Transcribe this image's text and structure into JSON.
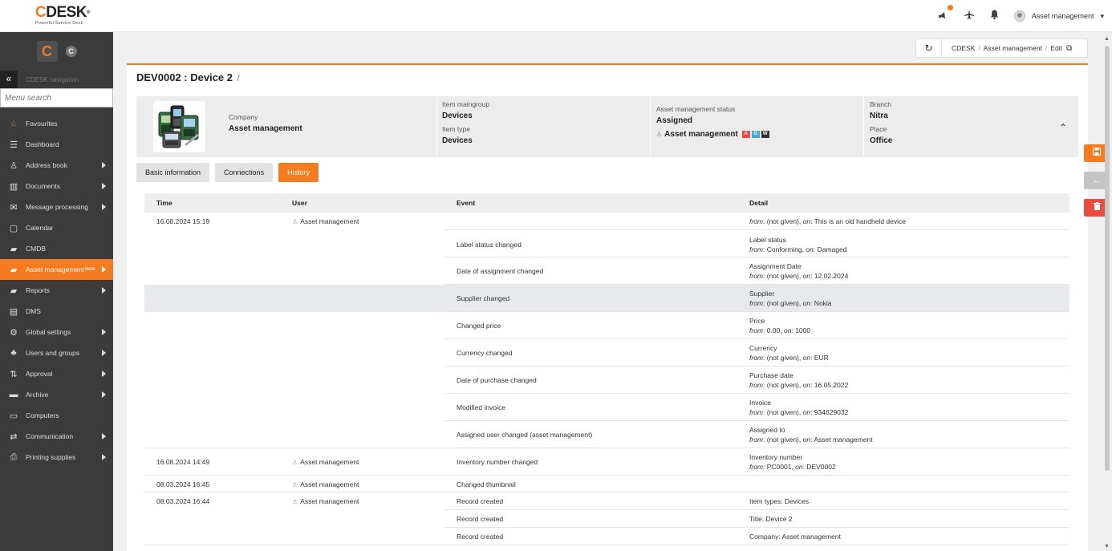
{
  "header": {
    "logo_text": "CDESK",
    "logo_c": "C",
    "logo_rest": "DESK",
    "logo_reg": "®",
    "logo_sub": "Powerful Service Desk",
    "user_name": "Asset management",
    "user_caret": "▾",
    "icons": [
      "megaphone-icon",
      "airplane-icon",
      "bell-icon",
      "avatar"
    ]
  },
  "sidebar": {
    "brand_big": "C",
    "brand_small": "C",
    "collapse_glyph": "«",
    "nav_title": "CDESK navigation",
    "search_placeholder": "Menu search",
    "items": [
      {
        "label": "Favourites",
        "icon": "☆",
        "arrow": false
      },
      {
        "label": "Dashboard",
        "icon": "☰",
        "arrow": false
      },
      {
        "label": "Address book",
        "icon": "♙",
        "arrow": true
      },
      {
        "label": "Documents",
        "icon": "▥",
        "arrow": true
      },
      {
        "label": "Message processing",
        "icon": "✉",
        "arrow": true
      },
      {
        "label": "Calendar",
        "icon": "▢",
        "arrow": false
      },
      {
        "label": "CMDB",
        "icon": "▰",
        "arrow": false
      },
      {
        "label": "Asset management",
        "icon": "▰",
        "arrow": true,
        "badge": "Beta"
      },
      {
        "label": "Reports",
        "icon": "▰",
        "arrow": true
      },
      {
        "label": "DMS",
        "icon": "▤",
        "arrow": false
      },
      {
        "label": "Global settings",
        "icon": "⚙",
        "arrow": true
      },
      {
        "label": "Users and groups",
        "icon": "♣",
        "arrow": true
      },
      {
        "label": "Approval",
        "icon": "⇅",
        "arrow": true
      },
      {
        "label": "Archive",
        "icon": "▬",
        "arrow": true
      },
      {
        "label": "Computers",
        "icon": "▭",
        "arrow": false
      },
      {
        "label": "Communication",
        "icon": "⇄",
        "arrow": true
      },
      {
        "label": "Printing supplies",
        "icon": "⎙",
        "arrow": true
      }
    ]
  },
  "breadcrumb": {
    "refresh_glyph": "↻",
    "part1": "CDESK",
    "part2": "Asset management",
    "part3": "Edit",
    "sep": "/",
    "edit_glyph": "⧉"
  },
  "page": {
    "title": "DEV0002 : Device 2",
    "title_suffix": "/"
  },
  "summary": {
    "company_label": "Company",
    "company_value": "Asset management",
    "maingroup_label": "Item maingroup",
    "maingroup_value": "Devices",
    "type_label": "Item type",
    "type_value": "Devices",
    "status_label": "Asset management status",
    "status_value": "Assigned",
    "owner_value": "Asset management",
    "tags": [
      {
        "text": "A",
        "color": "#e74c3c"
      },
      {
        "text": "O",
        "color": "#3fa9d9"
      },
      {
        "text": "W",
        "color": "#333333"
      }
    ],
    "branch_label": "Branch",
    "branch_value": "Nitra",
    "place_label": "Place",
    "place_value": "Office",
    "collapse_glyph": "⌃"
  },
  "tabs": [
    "Basic information",
    "Connections",
    "History"
  ],
  "history": {
    "headers": {
      "time": "Time",
      "user": "User",
      "event": "Event",
      "detail": "Detail"
    },
    "rows": [
      {
        "time": "16.08.2024 15:19",
        "user": "Asset management",
        "event": "",
        "detail_title": "",
        "detail_from_label": "from",
        "detail_from": ": (not given), ",
        "detail_on_label": "on",
        "detail_on": ": This is an old handheld device"
      },
      {
        "time": "",
        "user": "",
        "event": "Label status changed",
        "detail_title": "Label status",
        "detail_from_label": "from",
        "detail_from": ": Conforming, ",
        "detail_on_label": "on",
        "detail_on": ": Damaged"
      },
      {
        "time": "",
        "user": "",
        "event": "Date of assignment changed",
        "detail_title": "Assignment Date",
        "detail_from_label": "from",
        "detail_from": ": (not given), ",
        "detail_on_label": "on",
        "detail_on": ": 12.02.2024"
      },
      {
        "time": "",
        "user": "",
        "event": "Supplier changed",
        "detail_title": "Supplier",
        "detail_from_label": "from",
        "detail_from": ": (not given), ",
        "detail_on_label": "on",
        "detail_on": ": Nokia"
      },
      {
        "time": "",
        "user": "",
        "event": "Changed price",
        "detail_title": "Price",
        "detail_from_label": "from",
        "detail_from": ": 0.00, ",
        "detail_on_label": "on",
        "detail_on": ": 1000"
      },
      {
        "time": "",
        "user": "",
        "event": "Currency changed",
        "detail_title": "Currency",
        "detail_from_label": "from",
        "detail_from": ": (not given), ",
        "detail_on_label": "on",
        "detail_on": ": EUR"
      },
      {
        "time": "",
        "user": "",
        "event": "Date of purchase changed",
        "detail_title": "Purchase date",
        "detail_from_label": "from",
        "detail_from": ": (not given), ",
        "detail_on_label": "on",
        "detail_on": ": 16.05.2022"
      },
      {
        "time": "",
        "user": "",
        "event": "Modified invoice",
        "detail_title": "Invoice",
        "detail_from_label": "from",
        "detail_from": ": (not given), ",
        "detail_on_label": "on",
        "detail_on": ": 934629032"
      },
      {
        "time": "",
        "user": "",
        "event": "Assigned user changed (asset management)",
        "detail_title": "Assigned to",
        "detail_from_label": "from",
        "detail_from": ": (not given), ",
        "detail_on_label": "on",
        "detail_on": ": Asset management"
      },
      {
        "time": "16.08.2024 14:49",
        "user": "Asset management",
        "event": "Inventory number changed",
        "detail_title": "Inventory number",
        "detail_from_label": "from",
        "detail_from": ": PC0001, ",
        "detail_on_label": "on",
        "detail_on": ": DEV0002"
      },
      {
        "time": "08.03.2024 16:45",
        "user": "Asset management",
        "event": "Changed thumbnail",
        "detail_plain": ""
      },
      {
        "time": "08.03.2024 16:44",
        "user": "Asset management",
        "event": "Record created",
        "detail_plain": "Item types: Devices"
      },
      {
        "time": "",
        "user": "",
        "event": "Record created",
        "detail_plain": "Title: Device 2"
      },
      {
        "time": "",
        "user": "",
        "event": "Record created",
        "detail_plain": "Company: Asset management"
      }
    ]
  },
  "actions": {
    "save_glyph": "▣",
    "back_glyph": "←",
    "delete_glyph": "🗑"
  },
  "colors": {
    "accent": "#f47b20",
    "sidebar": "#3b3b3b",
    "delete": "#e74c3c"
  }
}
